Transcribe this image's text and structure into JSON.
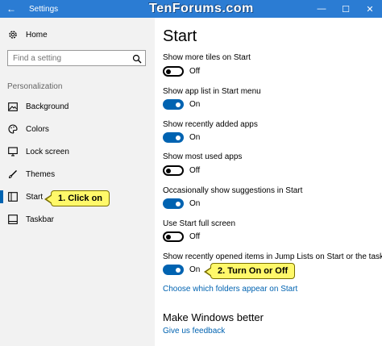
{
  "window": {
    "title": "Settings",
    "watermark": "TenForums.com",
    "minimize": "—",
    "maximize": "☐",
    "close": "✕",
    "back": "←"
  },
  "sidebar": {
    "home": "Home",
    "search_placeholder": "Find a setting",
    "section": "Personalization",
    "items": [
      {
        "label": "Background",
        "icon": "picture-icon"
      },
      {
        "label": "Colors",
        "icon": "palette-icon"
      },
      {
        "label": "Lock screen",
        "icon": "lock-screen-icon"
      },
      {
        "label": "Themes",
        "icon": "brush-icon"
      },
      {
        "label": "Start",
        "icon": "start-icon",
        "active": true
      },
      {
        "label": "Taskbar",
        "icon": "taskbar-icon"
      }
    ]
  },
  "main": {
    "title": "Start",
    "settings": [
      {
        "label": "Show more tiles on Start",
        "state": "Off",
        "on": false
      },
      {
        "label": "Show app list in Start menu",
        "state": "On",
        "on": true
      },
      {
        "label": "Show recently added apps",
        "state": "On",
        "on": true
      },
      {
        "label": "Show most used apps",
        "state": "Off",
        "on": false
      },
      {
        "label": "Occasionally show suggestions in Start",
        "state": "On",
        "on": true
      },
      {
        "label": "Use Start full screen",
        "state": "Off",
        "on": false
      },
      {
        "label": "Show recently opened items in Jump Lists on Start or the taskbar",
        "state": "On",
        "on": true
      }
    ],
    "folders_link": "Choose which folders appear on Start",
    "make_better": "Make Windows better",
    "feedback_link": "Give us feedback"
  },
  "callouts": {
    "one": "1. Click on",
    "two": "2. Turn On or Off"
  },
  "colors": {
    "accent": "#0063b1",
    "titlebar": "#2b7cd3",
    "callout": "#fff86a"
  }
}
